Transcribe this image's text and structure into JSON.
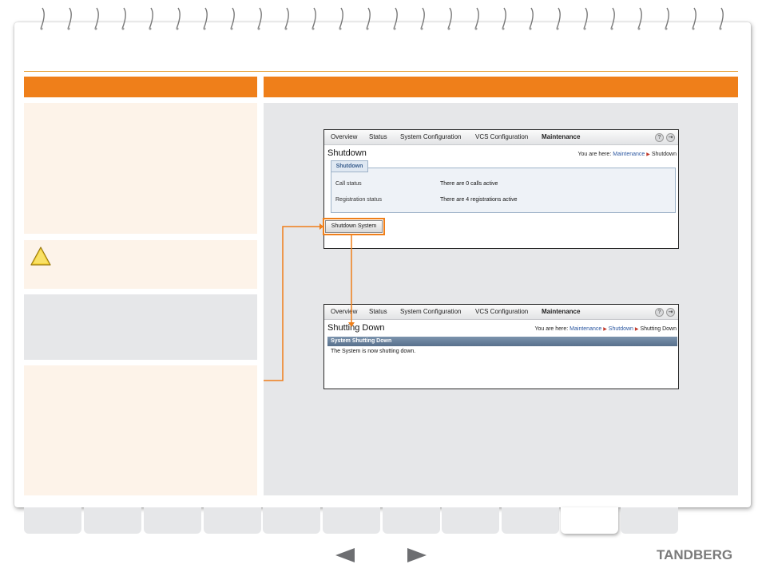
{
  "window1": {
    "nav": [
      "Overview",
      "Status",
      "System Configuration",
      "VCS Configuration",
      "Maintenance"
    ],
    "title": "Shutdown",
    "breadcrumb": {
      "prefix": "You are here:",
      "links": [
        "Maintenance"
      ],
      "current": "Shutdown"
    },
    "tab_label": "Shutdown",
    "rows": [
      {
        "label": "Call status",
        "value": "There are 0 calls active"
      },
      {
        "label": "Registration status",
        "value": "There are 4 registrations active"
      }
    ],
    "button_label": "Shutdown System"
  },
  "window2": {
    "nav": [
      "Overview",
      "Status",
      "System Configuration",
      "VCS Configuration",
      "Maintenance"
    ],
    "title": "Shutting Down",
    "breadcrumb": {
      "prefix": "You are here:",
      "links": [
        "Maintenance",
        "Shutdown"
      ],
      "current": "Shutting Down"
    },
    "section_header": "System Shutting Down",
    "message": "The System is now shutting down."
  },
  "icons": {
    "help": "?",
    "logout": "⇥"
  },
  "footer": {
    "brand": "TANDBERG"
  },
  "colors": {
    "accent": "#ef7f1a",
    "panel": "#e6e7e9",
    "cream": "#fdf3e9"
  }
}
